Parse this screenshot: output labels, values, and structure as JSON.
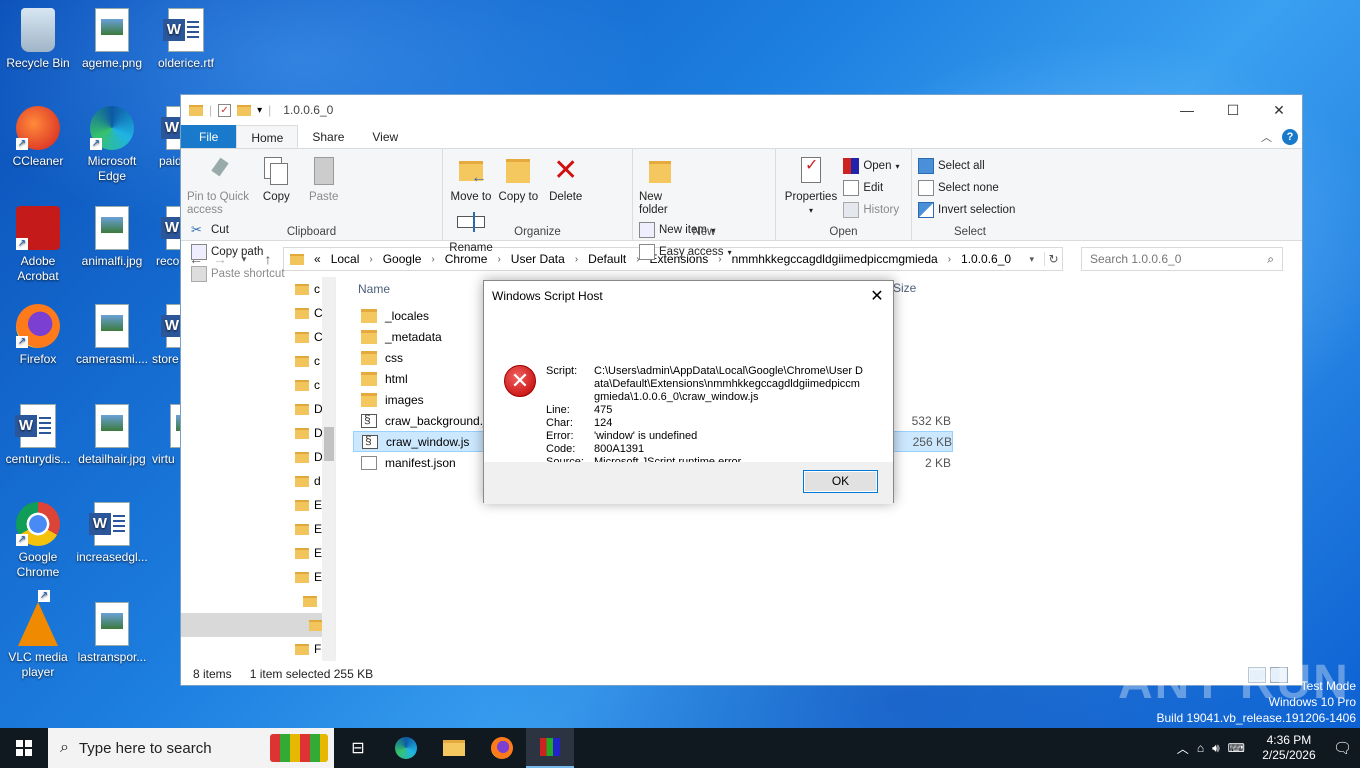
{
  "desktop": {
    "icons": [
      {
        "label": "Recycle Bin"
      },
      {
        "label": "ageme.png"
      },
      {
        "label": "olderice.rtf"
      },
      {
        "label": "CCleaner"
      },
      {
        "label": "Microsoft Edge"
      },
      {
        "label": "paid"
      },
      {
        "label": "Adobe Acrobat"
      },
      {
        "label": "animalfi.jpg"
      },
      {
        "label": "reco"
      },
      {
        "label": "Firefox"
      },
      {
        "label": "camerasmi...."
      },
      {
        "label": "store"
      },
      {
        "label": "centurydis..."
      },
      {
        "label": "detailhair.jpg"
      },
      {
        "label": "virtu"
      },
      {
        "label": "Google Chrome"
      },
      {
        "label": "increasedgl..."
      },
      {
        "label": "VLC media player"
      },
      {
        "label": "lastranspor..."
      }
    ]
  },
  "explorer": {
    "title": "1.0.0.6_0",
    "tabs": {
      "file": "File",
      "home": "Home",
      "share": "Share",
      "view": "View"
    },
    "ribbon": {
      "clipboard": {
        "label": "Clipboard",
        "pin": "Pin to Quick access",
        "copy": "Copy",
        "paste": "Paste",
        "cut": "Cut",
        "copy_path": "Copy path",
        "paste_shortcut": "Paste shortcut"
      },
      "organize": {
        "label": "Organize",
        "move_to": "Move to",
        "copy_to": "Copy to",
        "delete": "Delete",
        "rename": "Rename"
      },
      "new": {
        "label": "New",
        "new_folder": "New folder",
        "new_item": "New item",
        "easy_access": "Easy access"
      },
      "open": {
        "label": "Open",
        "properties": "Properties",
        "open": "Open",
        "edit": "Edit",
        "history": "History"
      },
      "select": {
        "label": "Select",
        "select_all": "Select all",
        "select_none": "Select none",
        "invert": "Invert selection"
      }
    },
    "address": {
      "prefix": "«",
      "crumbs": [
        "Local",
        "Google",
        "Chrome",
        "User Data",
        "Default",
        "Extensions",
        "nmmhkkegccagdldgiimedpiccmgmieda",
        "1.0.0.6_0"
      ]
    },
    "search_placeholder": "Search 1.0.0.6_0",
    "navpane": [
      "c",
      "C",
      "C",
      "c",
      "c",
      "D",
      "D",
      "D",
      "d",
      "E",
      "E",
      "E",
      "E",
      "",
      "",
      "F"
    ],
    "columns": {
      "name": "Name",
      "size": "Size"
    },
    "files": [
      {
        "name": "_locales",
        "type": "folder",
        "size": ""
      },
      {
        "name": "_metadata",
        "type": "folder",
        "size": ""
      },
      {
        "name": "css",
        "type": "folder",
        "size": ""
      },
      {
        "name": "html",
        "type": "folder",
        "size": ""
      },
      {
        "name": "images",
        "type": "folder",
        "size": ""
      },
      {
        "name": "craw_background.js",
        "type": "js",
        "size": "532 KB"
      },
      {
        "name": "craw_window.js",
        "type": "js",
        "size": "256 KB",
        "selected": true
      },
      {
        "name": "manifest.json",
        "type": "json",
        "size": "2 KB"
      }
    ],
    "status": {
      "count": "8 items",
      "selected": "1 item selected  255 KB"
    }
  },
  "dialog": {
    "title": "Windows Script Host",
    "fields": [
      {
        "k": "Script:",
        "v": "C:\\Users\\admin\\AppData\\Local\\Google\\Chrome\\User Data\\Default\\Extensions\\nmmhkkegccagdldgiimedpiccmgmieda\\1.0.0.6_0\\craw_window.js"
      },
      {
        "k": "Line:",
        "v": "475"
      },
      {
        "k": "Char:",
        "v": "124"
      },
      {
        "k": "Error:",
        "v": "'window' is undefined"
      },
      {
        "k": "Code:",
        "v": "800A1391"
      },
      {
        "k": "Source:",
        "v": "Microsoft JScript runtime error"
      }
    ],
    "ok": "OK"
  },
  "watermark": "ANY RUN",
  "os": {
    "line1": "Test Mode",
    "line2": "Windows 10 Pro",
    "line3": "Build 19041.vb_release.191206-1406"
  },
  "taskbar": {
    "search_placeholder": "Type here to search",
    "time": "4:36 PM",
    "date": "2/25/2026"
  }
}
